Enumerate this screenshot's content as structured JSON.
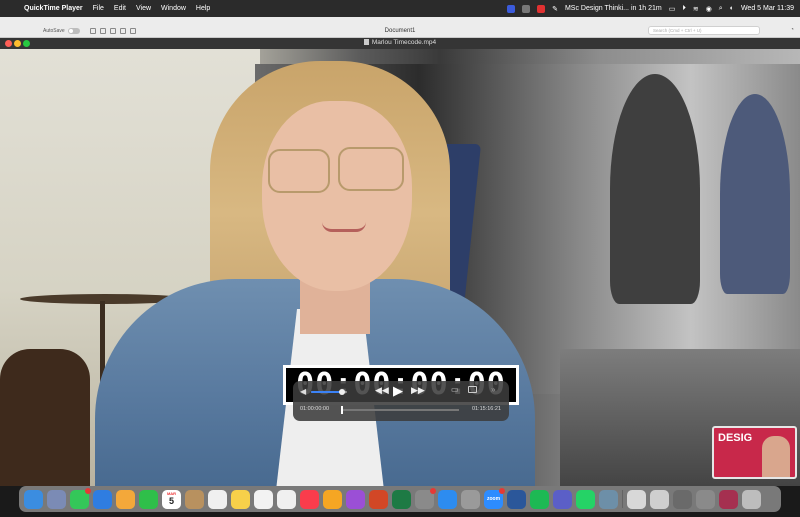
{
  "menubar": {
    "apple": "",
    "app_name": "QuickTime Player",
    "menus": [
      "File",
      "Edit",
      "View",
      "Window",
      "Help"
    ],
    "reminder": "MSc Design Thinki... in 1h 21m",
    "datetime": "Wed 5 Mar  11:39"
  },
  "word": {
    "autosave_label": "AutoSave",
    "doc_title": "Document1",
    "search_placeholder": "Search (Cmd + Ctrl + U)"
  },
  "quicktime": {
    "file_name": "Marlou Timecode.mp4",
    "timecode": "00:00:00:00",
    "current_time": "01:00:00:00",
    "end_time": "01:15:16:21",
    "volume": 0.85,
    "progress": 0.0,
    "icons": {
      "volume": "speaker-icon",
      "rewind": "rewind-icon",
      "play": "play-icon",
      "forward": "fast-forward-icon",
      "airplay": "airplay-icon",
      "pip": "picture-in-picture-icon",
      "share": "share-icon"
    }
  },
  "pip": {
    "text": "DESIG"
  },
  "dock": {
    "calendar_month": "MAR",
    "calendar_day": "5",
    "apps": [
      {
        "name": "Finder",
        "color": "#3b8de0"
      },
      {
        "name": "Launchpad",
        "color": "#7b8bb5"
      },
      {
        "name": "Messages",
        "color": "#34c759",
        "badge": true
      },
      {
        "name": "Safari",
        "color": "#2f7de1"
      },
      {
        "name": "Photos",
        "color": "#f4a83a"
      },
      {
        "name": "FaceTime",
        "color": "#2fbf4a"
      },
      {
        "name": "Calendar",
        "color": "#ffffff"
      },
      {
        "name": "Contacts",
        "color": "#b8915f"
      },
      {
        "name": "Reminders",
        "color": "#f0f0f0"
      },
      {
        "name": "Notes",
        "color": "#f7d04a"
      },
      {
        "name": "Freeform",
        "color": "#f2f2f2"
      },
      {
        "name": "Chrome",
        "color": "#f0f0f0"
      },
      {
        "name": "Music",
        "color": "#fa3c4c"
      },
      {
        "name": "Pages",
        "color": "#f5a623"
      },
      {
        "name": "Podcasts",
        "color": "#9b4fd6"
      },
      {
        "name": "PowerPoint",
        "color": "#d24726"
      },
      {
        "name": "Excel",
        "color": "#1d7a44"
      },
      {
        "name": "System Settings",
        "color": "#8a8a8a",
        "badge": true
      },
      {
        "name": "App Store",
        "color": "#2d8cf0"
      },
      {
        "name": "Signal",
        "color": "#9a9a9a"
      },
      {
        "name": "Zoom",
        "color": "#2d8cff",
        "label": "zoom",
        "badge": true
      },
      {
        "name": "Word",
        "color": "#2b579a"
      },
      {
        "name": "Spotify",
        "color": "#1db954"
      },
      {
        "name": "Teams",
        "color": "#5b5fc7"
      },
      {
        "name": "WhatsApp",
        "color": "#25d366"
      },
      {
        "name": "Disk Utility",
        "color": "#6d8fa8"
      }
    ],
    "recent": [
      {
        "name": "Downloads",
        "color": "#d8d8d8"
      },
      {
        "name": "Screenshot 1",
        "color": "#cfcfcf"
      },
      {
        "name": "Screenshot 2",
        "color": "#6a6a6a"
      },
      {
        "name": "Screenshot 3",
        "color": "#8a8a8a"
      },
      {
        "name": "Screenshot 4",
        "color": "#a53050"
      },
      {
        "name": "Trash",
        "color": "#bdbdbd"
      }
    ]
  }
}
